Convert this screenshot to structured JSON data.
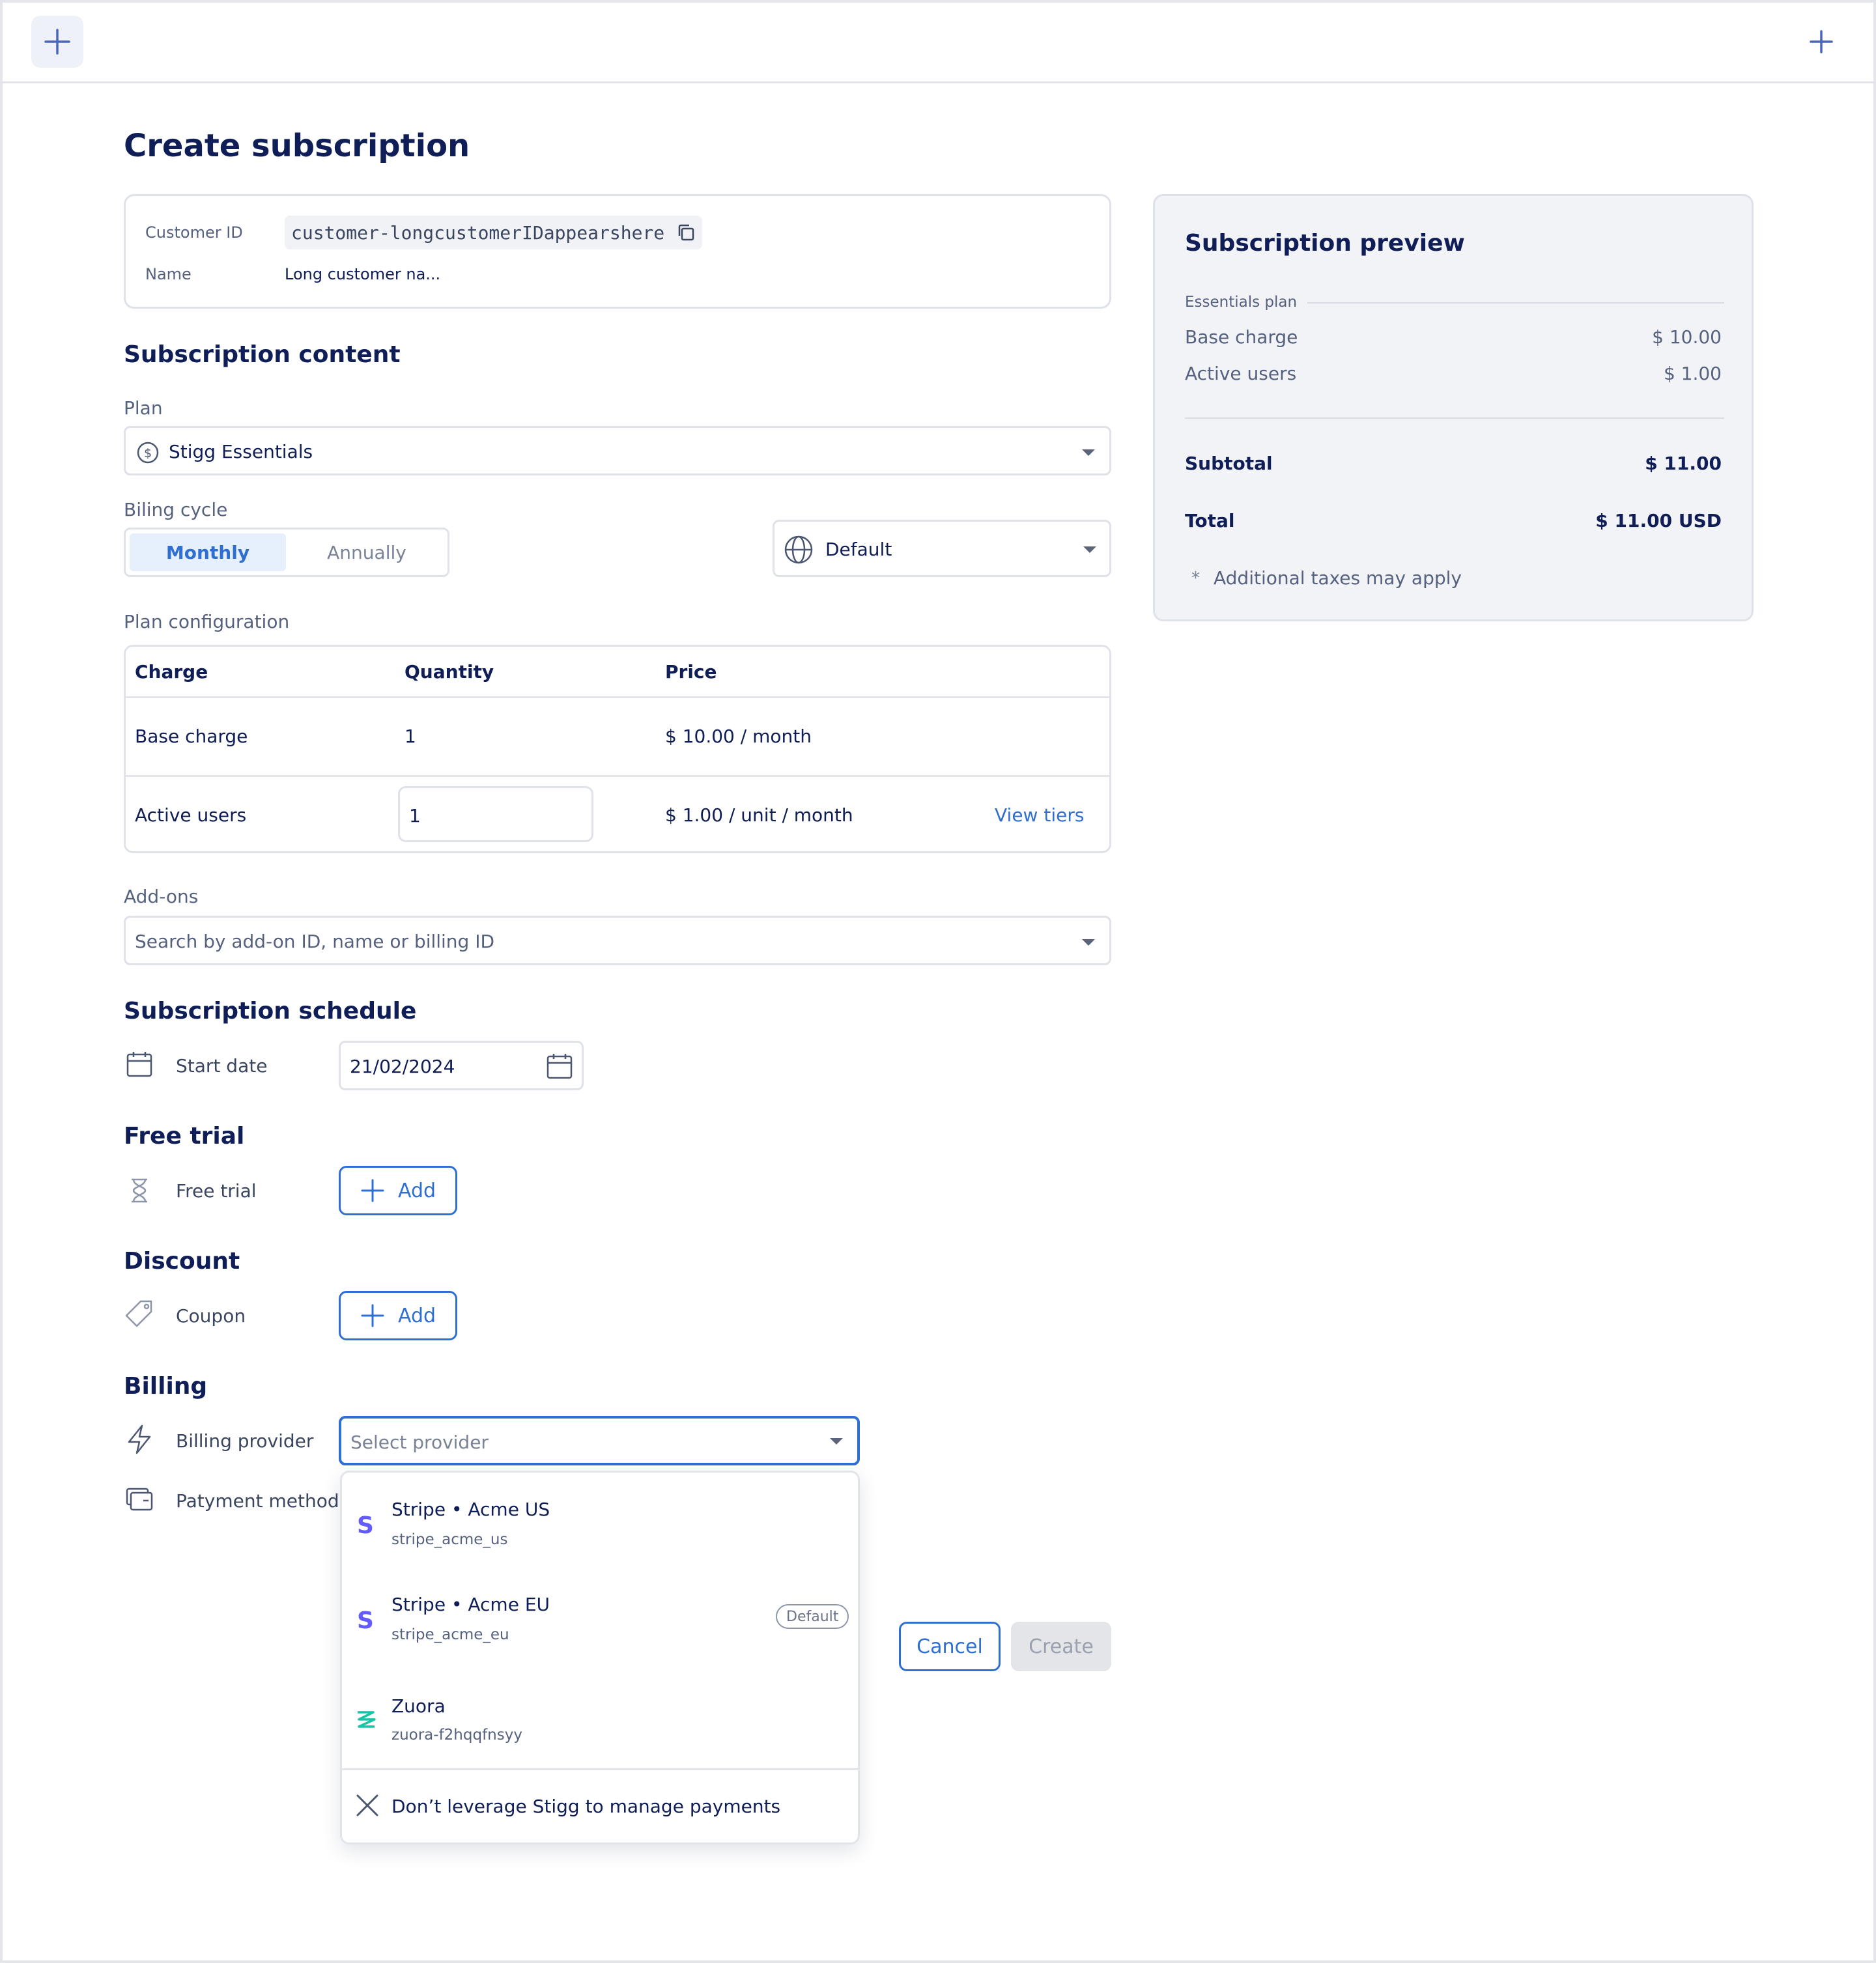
{
  "page_title": "Create subscription",
  "customer": {
    "id_label": "Customer ID",
    "id_value": "customer-longcustomerIDappearshere",
    "name_label": "Name",
    "name_value": "Long customer na..."
  },
  "content": {
    "heading": "Subscription content",
    "plan_label": "Plan",
    "plan_value": "Stigg Essentials",
    "billing_cycle_label": "Biling cycle",
    "cycle_monthly": "Monthly",
    "cycle_annually": "Annually",
    "region_value": "Default",
    "plan_config_label": "Plan configuration",
    "table": {
      "headers": [
        "Charge",
        "Quantity",
        "Price"
      ],
      "rows": [
        {
          "charge": "Base charge",
          "quantity": "1",
          "price": "$ 10.00 / month"
        },
        {
          "charge": "Active users",
          "quantity": "1",
          "price": "$ 1.00 / unit / month",
          "action": "View tiers"
        }
      ]
    },
    "addons_label": "Add-ons",
    "addons_placeholder": "Search by add-on ID, name or billing ID"
  },
  "schedule": {
    "heading": "Subscription schedule",
    "start_date_label": "Start date",
    "start_date_value": "21/02/2024"
  },
  "trial": {
    "heading": "Free trial",
    "label": "Free trial",
    "add_label": "Add"
  },
  "discount": {
    "heading": "Discount",
    "label": "Coupon",
    "add_label": "Add"
  },
  "billing": {
    "heading": "Billing",
    "provider_label": "Billing provider",
    "provider_placeholder": "Select provider",
    "payment_label": "Patyment method",
    "options": [
      {
        "title": "Stripe • Acme US",
        "sub": "stripe_acme_us",
        "icon": "stripe-icon"
      },
      {
        "title": "Stripe • Acme EU",
        "sub": "stripe_acme_eu",
        "icon": "stripe-icon",
        "badge": "Default"
      },
      {
        "title": "Zuora",
        "sub": "zuora-f2hqqfnsyy",
        "icon": "zuora-icon"
      }
    ],
    "no_provider": "Don’t leverage Stigg to manage payments"
  },
  "actions": {
    "cancel": "Cancel",
    "create": "Create"
  },
  "preview": {
    "heading": "Subscription preview",
    "plan_name": "Essentials plan",
    "lines": [
      {
        "label": "Base charge",
        "value": "$ 10.00"
      },
      {
        "label": "Active users",
        "value": "$ 1.00"
      }
    ],
    "subtotal_label": "Subtotal",
    "subtotal_value": "$ 11.00",
    "total_label": "Total",
    "total_value": "$ 11.00 USD",
    "taxes_note": "Additional taxes may apply"
  },
  "colors": {
    "primary": "#2e6fd1",
    "navy": "#0f1e57",
    "stripe": "#635bff",
    "zuora": "#19c4a5"
  }
}
